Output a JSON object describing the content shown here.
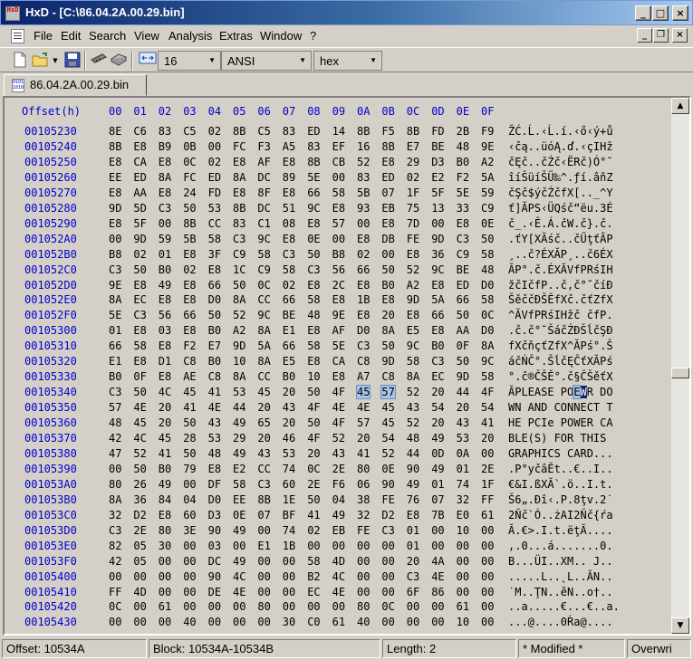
{
  "window": {
    "title": "HxD - [C:\\86.04.2A.00.29.bin]",
    "app_icon_text": "HxD",
    "minimize": "_",
    "maximize": "□",
    "close": "×"
  },
  "menu": {
    "items": [
      "File",
      "Edit",
      "Search",
      "View",
      "Analysis",
      "Extras",
      "Window",
      "?"
    ],
    "mdi_minimize": "_",
    "mdi_restore": "❐",
    "mdi_close": "×"
  },
  "toolbar": {
    "bytes_per_row": "16",
    "charset": "ANSI",
    "offset_base": "hex",
    "icons": [
      "new-file-icon",
      "open-folder-icon",
      "save-disk-icon",
      "ram-icon",
      "disk-icon",
      "columns-icon"
    ]
  },
  "tab": {
    "label": "86.04.2A.00.29.bin"
  },
  "hex_header": {
    "offset_label": "Offset(h)",
    "columns": [
      "00",
      "01",
      "02",
      "03",
      "04",
      "05",
      "06",
      "07",
      "08",
      "09",
      "0A",
      "0B",
      "0C",
      "0D",
      "0E",
      "0F"
    ]
  },
  "rows": [
    {
      "offset": "00105230",
      "bytes": [
        "8E",
        "C6",
        "83",
        "C5",
        "02",
        "8B",
        "C5",
        "83",
        "ED",
        "14",
        "8B",
        "F5",
        "8B",
        "FD",
        "2B",
        "F9"
      ],
      "text": "ŽĆ.Ĺ.‹Ĺ.í.‹ő‹ý+ů"
    },
    {
      "offset": "00105240",
      "bytes": [
        "8B",
        "E8",
        "B9",
        "0B",
        "00",
        "FC",
        "F3",
        "A5",
        "83",
        "EF",
        "16",
        "8B",
        "E7",
        "BE",
        "48",
        "9E"
      ],
      "text": "‹čą..üóĄ.ď.‹çIHž"
    },
    {
      "offset": "00105250",
      "bytes": [
        "E8",
        "CA",
        "E8",
        "0C",
        "02",
        "E8",
        "AF",
        "E8",
        "8B",
        "CB",
        "52",
        "E8",
        "29",
        "D3",
        "B0",
        "A2"
      ],
      "text": "čĘč..čŻč‹ËRč)Ó°˘"
    },
    {
      "offset": "00105260",
      "bytes": [
        "EE",
        "ED",
        "8A",
        "FC",
        "ED",
        "8A",
        "DC",
        "89",
        "5E",
        "00",
        "83",
        "ED",
        "02",
        "E2",
        "F2",
        "5A"
      ],
      "text": "îíŠüíŠÜ‰^.ƒí.âňZ"
    },
    {
      "offset": "00105270",
      "bytes": [
        "E8",
        "AA",
        "E8",
        "24",
        "FD",
        "E8",
        "8F",
        "E8",
        "66",
        "58",
        "5B",
        "07",
        "1F",
        "5F",
        "5E",
        "59"
      ],
      "text": "čŞč$ýčŹčfX[.._^Y"
    },
    {
      "offset": "00105280",
      "bytes": [
        "9D",
        "5D",
        "C3",
        "50",
        "53",
        "8B",
        "DC",
        "51",
        "9C",
        "E8",
        "93",
        "EB",
        "75",
        "13",
        "33",
        "C9"
      ],
      "text": "ť]ĂPS‹ÜQśč“ëu.3É"
    },
    {
      "offset": "00105290",
      "bytes": [
        "E8",
        "5F",
        "00",
        "8B",
        "CC",
        "83",
        "C1",
        "08",
        "E8",
        "57",
        "00",
        "E8",
        "7D",
        "00",
        "E8",
        "0E"
      ],
      "text": "č_.‹Ě.Á.čW.č}.č."
    },
    {
      "offset": "001052A0",
      "bytes": [
        "00",
        "9D",
        "59",
        "5B",
        "58",
        "C3",
        "9C",
        "E8",
        "0E",
        "00",
        "E8",
        "DB",
        "FE",
        "9D",
        "C3",
        "50"
      ],
      "text": ".ťY[XĂśč..čŰţťĂP"
    },
    {
      "offset": "001052B0",
      "bytes": [
        "B8",
        "02",
        "01",
        "E8",
        "3F",
        "C9",
        "58",
        "C3",
        "50",
        "B8",
        "02",
        "00",
        "E8",
        "36",
        "C9",
        "58"
      ],
      "text": "¸..č?ÉXĂP¸..č6ÉX"
    },
    {
      "offset": "001052C0",
      "bytes": [
        "C3",
        "50",
        "B0",
        "02",
        "E8",
        "1C",
        "C9",
        "58",
        "C3",
        "56",
        "66",
        "50",
        "52",
        "9C",
        "BE",
        "48"
      ],
      "text": "ĂP°.č.ÉXĂVfPRśIH"
    },
    {
      "offset": "001052D0",
      "bytes": [
        "9E",
        "E8",
        "49",
        "E8",
        "66",
        "50",
        "0C",
        "02",
        "E8",
        "2C",
        "E8",
        "B0",
        "A2",
        "E8",
        "ED",
        "D0"
      ],
      "text": "žčIčfP..č,č°˘číĐ"
    },
    {
      "offset": "001052E0",
      "bytes": [
        "8A",
        "EC",
        "E8",
        "E8",
        "D0",
        "8A",
        "CC",
        "66",
        "58",
        "E8",
        "1B",
        "E8",
        "9D",
        "5A",
        "66",
        "58"
      ],
      "text": "ŠěččĐŠĚfXč.čťZfX"
    },
    {
      "offset": "001052F0",
      "bytes": [
        "5E",
        "C3",
        "56",
        "66",
        "50",
        "52",
        "9C",
        "BE",
        "48",
        "9E",
        "E8",
        "20",
        "E8",
        "66",
        "50",
        "0C"
      ],
      "text": "^ĂVfPRśIHžč čfP."
    },
    {
      "offset": "00105300",
      "bytes": [
        "01",
        "E8",
        "03",
        "E8",
        "B0",
        "A2",
        "8A",
        "E1",
        "E8",
        "AF",
        "D0",
        "8A",
        "E5",
        "E8",
        "AA",
        "D0"
      ],
      "text": ".č.č°˘ŠáčŻĐŠĺčŞĐ"
    },
    {
      "offset": "00105310",
      "bytes": [
        "66",
        "58",
        "E8",
        "F2",
        "E7",
        "9D",
        "5A",
        "66",
        "58",
        "5E",
        "C3",
        "50",
        "9C",
        "B0",
        "0F",
        "8A"
      ],
      "text": "fXčňçťZfX^ĂPś°.Š"
    },
    {
      "offset": "00105320",
      "bytes": [
        "E1",
        "E8",
        "D1",
        "C8",
        "B0",
        "10",
        "8A",
        "E5",
        "E8",
        "CA",
        "C8",
        "9D",
        "58",
        "C3",
        "50",
        "9C"
      ],
      "text": "áčŃČ°.ŠĺčĘČťXĂPś"
    },
    {
      "offset": "00105330",
      "bytes": [
        "B0",
        "0F",
        "E8",
        "AE",
        "C8",
        "8A",
        "CC",
        "B0",
        "10",
        "E8",
        "A7",
        "C8",
        "8A",
        "EC",
        "9D",
        "58"
      ],
      "text": "°.č®ČŠĚ°.č§ČŠěťX"
    },
    {
      "offset": "00105340",
      "bytes": [
        "C3",
        "50",
        "4C",
        "45",
        "41",
        "53",
        "45",
        "20",
        "50",
        "4F",
        "45",
        "57",
        "52",
        "20",
        "44",
        "4F"
      ],
      "text_pre": "ĂPLEASE PO",
      "text_hl2": "E",
      "text_hl": "W",
      "text_post": "R DO"
    },
    {
      "offset": "00105350",
      "bytes": [
        "57",
        "4E",
        "20",
        "41",
        "4E",
        "44",
        "20",
        "43",
        "4F",
        "4E",
        "4E",
        "45",
        "43",
        "54",
        "20",
        "54"
      ],
      "text": "WN AND CONNECT T"
    },
    {
      "offset": "00105360",
      "bytes": [
        "48",
        "45",
        "20",
        "50",
        "43",
        "49",
        "65",
        "20",
        "50",
        "4F",
        "57",
        "45",
        "52",
        "20",
        "43",
        "41"
      ],
      "text": "HE PCIe POWER CA"
    },
    {
      "offset": "00105370",
      "bytes": [
        "42",
        "4C",
        "45",
        "28",
        "53",
        "29",
        "20",
        "46",
        "4F",
        "52",
        "20",
        "54",
        "48",
        "49",
        "53",
        "20"
      ],
      "text": "BLE(S) FOR THIS "
    },
    {
      "offset": "00105380",
      "bytes": [
        "47",
        "52",
        "41",
        "50",
        "48",
        "49",
        "43",
        "53",
        "20",
        "43",
        "41",
        "52",
        "44",
        "0D",
        "0A",
        "00"
      ],
      "text": "GRAPHICS CARD..."
    },
    {
      "offset": "00105390",
      "bytes": [
        "00",
        "50",
        "B0",
        "79",
        "E8",
        "E2",
        "CC",
        "74",
        "0C",
        "2E",
        "80",
        "0E",
        "90",
        "49",
        "01",
        "2E"
      ],
      "text": ".P°yčâĚt..€..I.."
    },
    {
      "offset": "001053A0",
      "bytes": [
        "80",
        "26",
        "49",
        "00",
        "DF",
        "58",
        "C3",
        "60",
        "2E",
        "F6",
        "06",
        "90",
        "49",
        "01",
        "74",
        "1F"
      ],
      "text": "€&I.ßXĂ`.ö..I.t."
    },
    {
      "offset": "001053B0",
      "bytes": [
        "8A",
        "36",
        "84",
        "04",
        "D0",
        "EE",
        "8B",
        "1E",
        "50",
        "04",
        "38",
        "FE",
        "76",
        "07",
        "32",
        "FF"
      ],
      "text": "Š6„.Đî‹.P.8ţv.2˙"
    },
    {
      "offset": "001053C0",
      "bytes": [
        "32",
        "D2",
        "E8",
        "60",
        "D3",
        "0E",
        "07",
        "BF",
        "41",
        "49",
        "32",
        "D2",
        "E8",
        "7B",
        "E0",
        "61"
      ],
      "text": "2Ňč`Ó..żAI2Ňč{ŕa"
    },
    {
      "offset": "001053D0",
      "bytes": [
        "C3",
        "2E",
        "80",
        "3E",
        "90",
        "49",
        "00",
        "74",
        "02",
        "EB",
        "FE",
        "C3",
        "01",
        "00",
        "10",
        "00"
      ],
      "text": "Ă.€>.I.t.ëţĂ...."
    },
    {
      "offset": "001053E0",
      "bytes": [
        "82",
        "05",
        "30",
        "00",
        "03",
        "00",
        "E1",
        "1B",
        "00",
        "00",
        "00",
        "00",
        "01",
        "00",
        "00",
        "00"
      ],
      "text": "‚.0...á.......0."
    },
    {
      "offset": "001053F0",
      "bytes": [
        "42",
        "05",
        "00",
        "00",
        "DC",
        "49",
        "00",
        "00",
        "58",
        "4D",
        "00",
        "00",
        "20",
        "4A",
        "00",
        "00"
      ],
      "text": "B...ÜI..XM.. J.."
    },
    {
      "offset": "00105400",
      "bytes": [
        "00",
        "00",
        "00",
        "00",
        "90",
        "4C",
        "00",
        "00",
        "B2",
        "4C",
        "00",
        "00",
        "C3",
        "4E",
        "00",
        "00"
      ],
      "text": ".....L..˛L..ĂN.."
    },
    {
      "offset": "00105410",
      "bytes": [
        "FF",
        "4D",
        "00",
        "00",
        "DE",
        "4E",
        "00",
        "00",
        "EC",
        "4E",
        "00",
        "00",
        "6F",
        "86",
        "00",
        "00"
      ],
      "text": "˙M..ŢN..ěN..o†.."
    },
    {
      "offset": "00105420",
      "bytes": [
        "0C",
        "00",
        "61",
        "00",
        "00",
        "00",
        "80",
        "00",
        "00",
        "00",
        "80",
        "0C",
        "00",
        "00",
        "61",
        "00"
      ],
      "text": "..a.....€...€..a."
    },
    {
      "offset": "00105430",
      "bytes": [
        "00",
        "00",
        "00",
        "40",
        "00",
        "00",
        "00",
        "30",
        "C0",
        "61",
        "40",
        "00",
        "00",
        "00",
        "10",
        "00"
      ],
      "text": "...@....0Ŕa@...."
    }
  ],
  "status": {
    "offset": "Offset: 10534A",
    "block": "Block: 10534A-10534B",
    "length": "Length: 2",
    "modified": "* Modified *",
    "mode": "Overwri"
  }
}
